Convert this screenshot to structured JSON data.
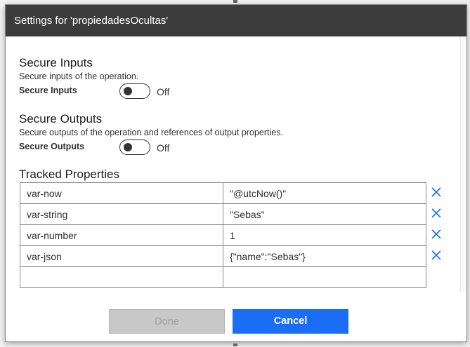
{
  "dialog": {
    "title": "Settings for 'propiedadesOcultas'"
  },
  "secure_inputs": {
    "title": "Secure Inputs",
    "description": "Secure inputs of the operation.",
    "toggle_label": "Secure Inputs",
    "state": "Off"
  },
  "secure_outputs": {
    "title": "Secure Outputs",
    "description": "Secure outputs of the operation and references of output properties.",
    "toggle_label": "Secure Outputs",
    "state": "Off"
  },
  "tracked_properties": {
    "title": "Tracked Properties",
    "rows": [
      {
        "key": "var-now",
        "value": "\"@utcNow()\""
      },
      {
        "key": "var-string",
        "value": "\"Sebas\""
      },
      {
        "key": "var-number",
        "value": "1"
      },
      {
        "key": "var-json",
        "value": "{\"name\":\"Sebas\"}"
      },
      {
        "key": "",
        "value": ""
      }
    ]
  },
  "buttons": {
    "done": "Done",
    "cancel": "Cancel"
  },
  "colors": {
    "header_bg": "#3c3c3c",
    "primary": "#1a6ef5",
    "remove_icon": "#1a6ef5"
  }
}
